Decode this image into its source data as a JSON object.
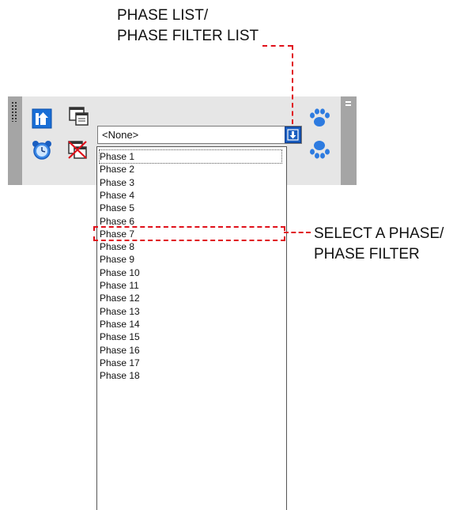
{
  "callouts": {
    "top_line1": "PHASE LIST/",
    "top_line2": "PHASE FILTER LIST",
    "right_line1": "SELECT A PHASE/",
    "right_line2": "PHASE FILTER"
  },
  "toolbar": {
    "icons": [
      "phase-up-icon",
      "window-icon",
      "alarm-clock-icon",
      "delete-window-icon",
      "paw-prints-icon",
      "paw-prints-down-icon"
    ],
    "accent_color": "#1a5ec0",
    "highlight_color": "#e0101a"
  },
  "phase_combo": {
    "selected_value": "<None>"
  },
  "phase_list": {
    "items": [
      "Phase 1",
      "Phase 2",
      "Phase 3",
      "Phase 4",
      "Phase 5",
      "Phase 6",
      "Phase 7",
      "Phase 8",
      "Phase 9",
      "Phase 10",
      "Phase 11",
      "Phase 12",
      "Phase 13",
      "Phase 14",
      "Phase 15",
      "Phase 16",
      "Phase 17",
      "Phase 18"
    ],
    "focused_item": "Phase 1",
    "highlighted_item": "Phase 7"
  }
}
